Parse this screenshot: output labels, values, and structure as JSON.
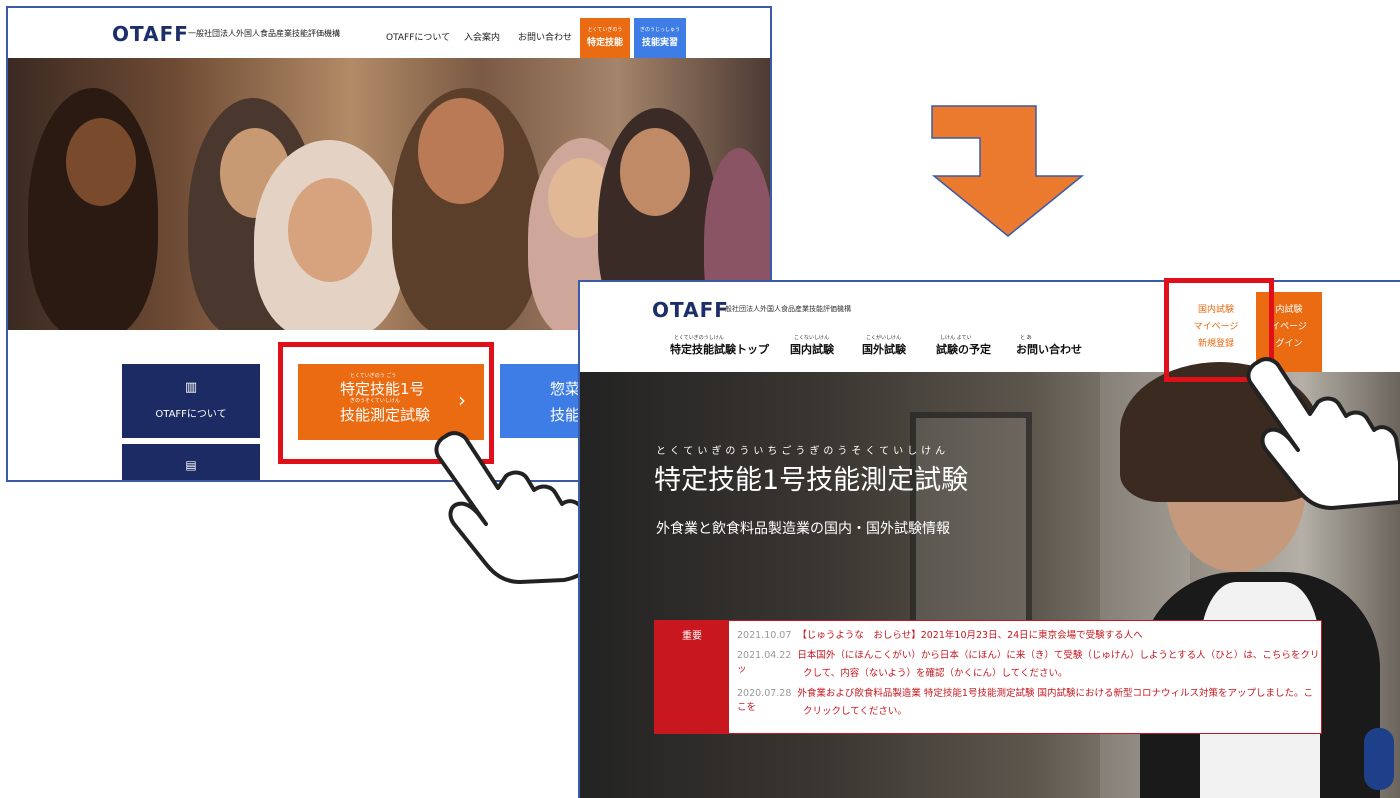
{
  "screenshot1": {
    "logo": "OTAFF",
    "org_name": "一般社団法人外国人食品産業技能評価機構",
    "nav": [
      "OTAFFについて",
      "入会案内",
      "お問い合わせ"
    ],
    "tab_specified": {
      "ruby": "とくていぎのう",
      "label": "特定技能"
    },
    "tab_training": {
      "ruby": "ぎのうじっしゅう",
      "label": "技能実習"
    },
    "tiles": {
      "about": "OTAFFについて",
      "exam_ruby_1": "とくていぎのう ごう",
      "exam_line1": "特定技能1号",
      "exam_ruby_2": "ぎのうそくていしけん",
      "exam_line2": "技能測定試験",
      "food_line1": "惣菜",
      "food_line2": "技能"
    }
  },
  "screenshot2": {
    "logo": "OTAFF",
    "org_name": "一般社団法人外国人食品産業技能評価機構",
    "nav": [
      {
        "ruby": "とくていぎのうしけん",
        "label": "特定技能試験トップ"
      },
      {
        "ruby": "こくないしけん",
        "label": "国内試験"
      },
      {
        "ruby": "こくがいしけん",
        "label": "国外試験"
      },
      {
        "ruby": "しけん よてい",
        "label": "試験の予定"
      },
      {
        "ruby": "と あ",
        "label": "お問い合わせ"
      }
    ],
    "domestic_panel": [
      "国内試験",
      "マイページ",
      "新規登録"
    ],
    "login_panel": [
      "内試験",
      "イページ",
      "グイン"
    ],
    "hero_ruby": "とくていぎのういちごうぎのうそくていしけん",
    "hero_title": "特定技能1号技能測定試験",
    "hero_subtitle": "外食業と飲食料品製造業の国内・国外試験情報",
    "news_tag": "重要",
    "news": [
      {
        "date": "2021.10.07",
        "text": "【じゅうような　おしらせ】2021年10月23日、24日に東京会場で受験する人へ"
      },
      {
        "date": "2021.04.22",
        "text": "日本国外（にほんこくがい）から日本（にほん）に来（き）て受験（じゅけん）しようとする人（ひと）は、こちらをクリッ"
      },
      {
        "date": "",
        "text": "クして、内容（ないよう）を確認（かくにん）してください。"
      },
      {
        "date": "2020.07.28",
        "text": "外食業および飲食料品製造業 特定技能1号技能測定試験 国内試験における新型コロナウィルス対策をアップしました。ここを"
      },
      {
        "date": "",
        "text": "クリックしてください。"
      }
    ]
  },
  "colors": {
    "orange": "#ea6b12",
    "navy": "#1c2b63",
    "blue": "#3e7ce6",
    "highlight_red": "#e0101a",
    "arrow": "#ec7a2e"
  },
  "icons": [
    "arrow-down-icon",
    "pointing-hand-icon",
    "building-icon",
    "document-icon",
    "chevron-right-icon"
  ]
}
